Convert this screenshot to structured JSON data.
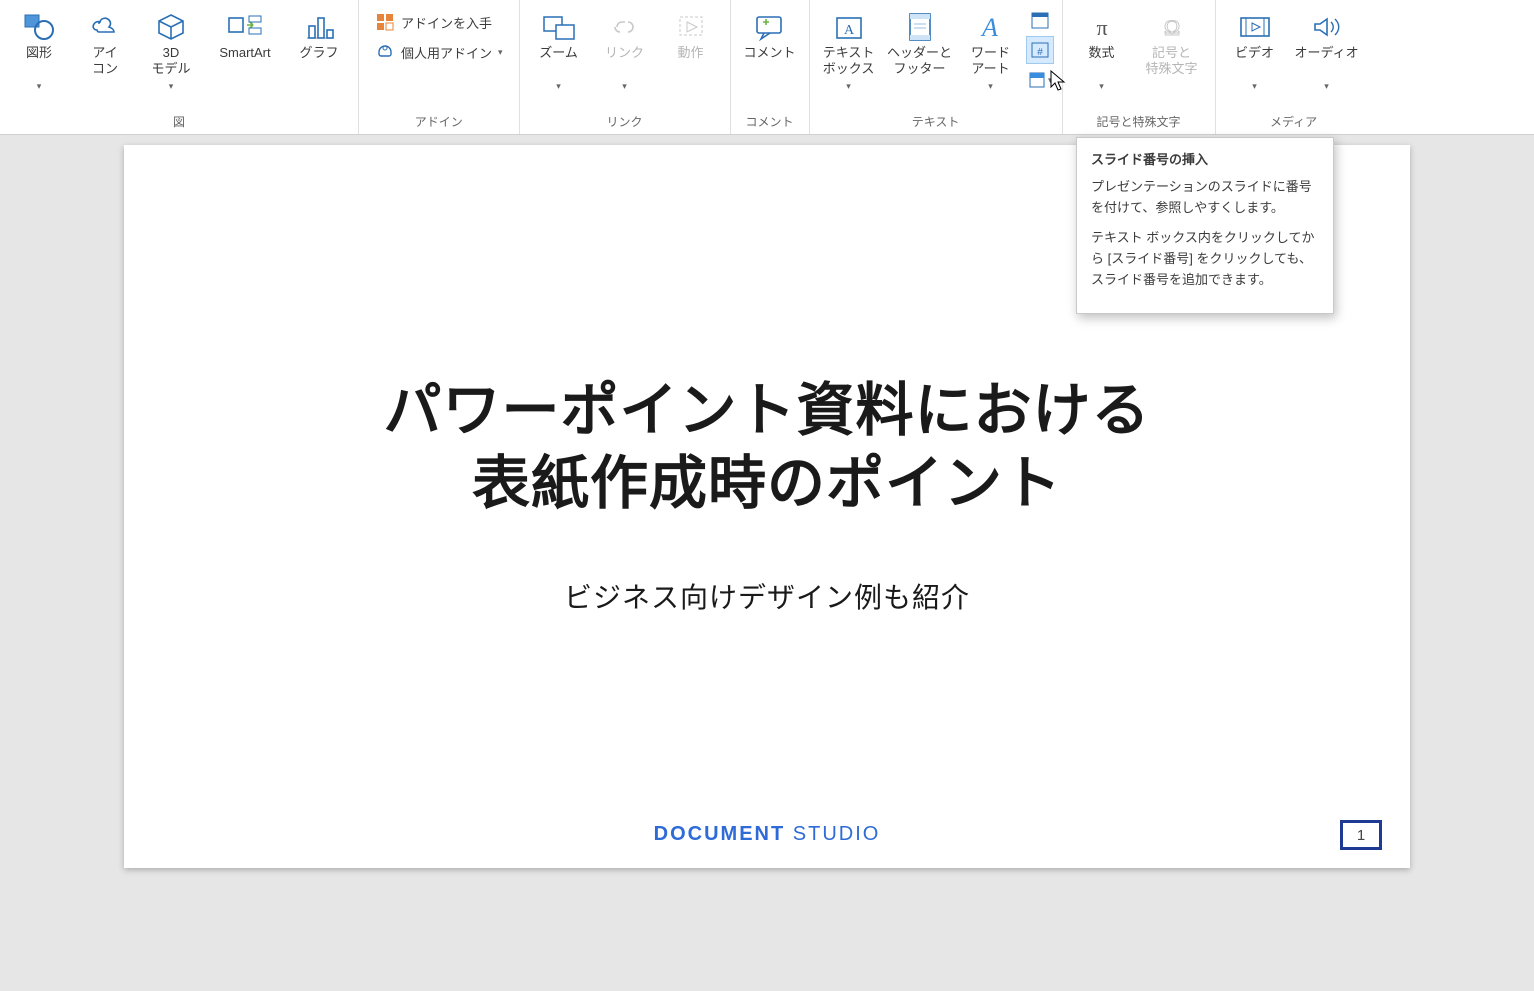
{
  "ribbon": {
    "illustrations": {
      "label": "図",
      "shapes": "図形",
      "icons": "アイ\nコン",
      "models3d": "3D\nモデル",
      "smartart": "SmartArt",
      "chart": "グラフ"
    },
    "addins": {
      "label": "アドイン",
      "get": "アドインを入手",
      "my": "個人用アドイン"
    },
    "links": {
      "label": "リンク",
      "zoom": "ズーム",
      "link": "リンク",
      "action": "動作"
    },
    "comments": {
      "label": "コメント",
      "comment": "コメント"
    },
    "text": {
      "label": "テキスト",
      "textbox": "テキスト\nボックス",
      "headerfooter": "ヘッダーと\nフッター",
      "wordart": "ワード\nアート"
    },
    "symbols": {
      "label": "記号と特殊文字",
      "equation": "数式",
      "symbol": "記号と\n特殊文字"
    },
    "media": {
      "label": "メディア",
      "video": "ビデオ",
      "audio": "オーディオ"
    }
  },
  "tooltip": {
    "title": "スライド番号の挿入",
    "p1": "プレゼンテーションのスライドに番号を付けて、参照しやすくします。",
    "p2": "テキスト ボックス内をクリックしてから [スライド番号] をクリックしても、スライド番号を追加できます。"
  },
  "slide": {
    "title": "パワーポイント資料における\n表紙作成時のポイント",
    "subtitle": "ビジネス向けデザイン例も紹介",
    "logo_bold": "DOCUMENT",
    "logo_thin": " STUDIO",
    "page_number": "1"
  }
}
